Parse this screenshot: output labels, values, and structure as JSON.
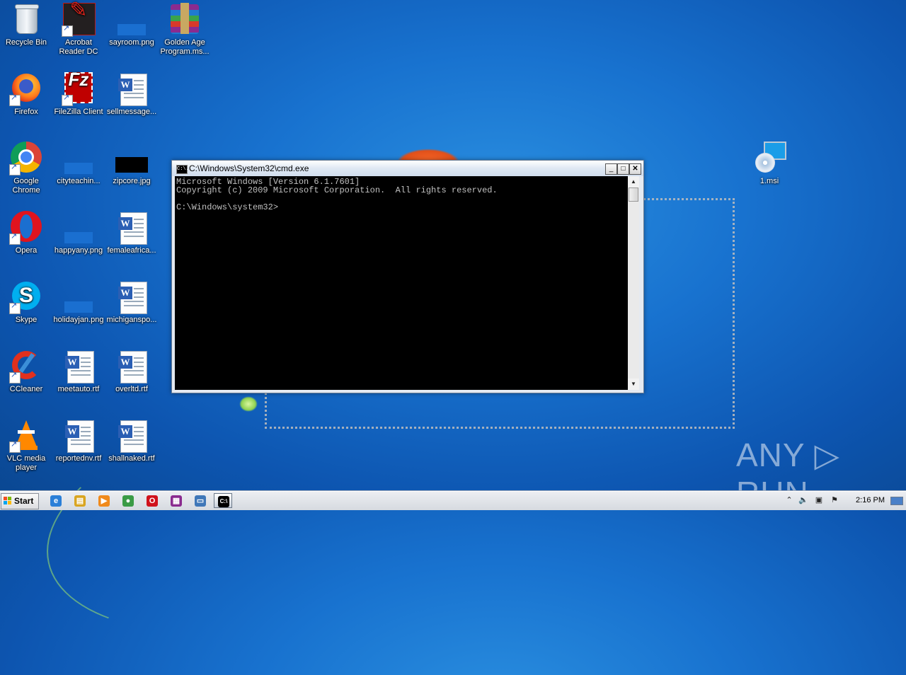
{
  "desktop_icons": [
    {
      "label": "Recycle Bin",
      "icon": "recycle-bin-icon"
    },
    {
      "label": "Acrobat Reader DC",
      "icon": "acrobat-icon"
    },
    {
      "label": "sayroom.png",
      "icon": "image-file-icon"
    },
    {
      "label": "Golden Age Program.ms...",
      "icon": "winrar-icon"
    },
    {
      "label": "Firefox",
      "icon": "firefox-icon"
    },
    {
      "label": "FileZilla Client",
      "icon": "filezilla-icon"
    },
    {
      "label": "sellmessage...",
      "icon": "word-doc-icon"
    },
    {
      "label": "Google Chrome",
      "icon": "chrome-icon"
    },
    {
      "label": "cityteachin...",
      "icon": "image-file-icon"
    },
    {
      "label": "zipcore.jpg",
      "icon": "image-file-icon"
    },
    {
      "label": "Opera",
      "icon": "opera-icon"
    },
    {
      "label": "happyany.png",
      "icon": "image-file-icon"
    },
    {
      "label": "femaleafrica...",
      "icon": "word-doc-icon"
    },
    {
      "label": "Skype",
      "icon": "skype-icon"
    },
    {
      "label": "holidayjan.png",
      "icon": "image-file-icon"
    },
    {
      "label": "michiganspo...",
      "icon": "word-doc-icon"
    },
    {
      "label": "CCleaner",
      "icon": "ccleaner-icon"
    },
    {
      "label": "meetauto.rtf",
      "icon": "word-doc-icon"
    },
    {
      "label": "overltd.rtf",
      "icon": "word-doc-icon"
    },
    {
      "label": "VLC media player",
      "icon": "vlc-icon"
    },
    {
      "label": "reportednv.rtf",
      "icon": "word-doc-icon"
    },
    {
      "label": "shallnaked.rtf",
      "icon": "word-doc-icon"
    },
    {
      "label": "1.msi",
      "icon": "msi-installer-icon"
    }
  ],
  "cmd_window": {
    "title": "C:\\Windows\\System32\\cmd.exe",
    "icon_text": "C:\\.",
    "minimize": "_",
    "maximize": "□",
    "close": "✕",
    "console_lines": "Microsoft Windows [Version 6.1.7601]\nCopyright (c) 2009 Microsoft Corporation.  All rights reserved.\n\nC:\\Windows\\system32>",
    "scroll_up": "▲",
    "scroll_down": "▼"
  },
  "watermark": "ANY ▷ RUN",
  "taskbar": {
    "start_label": "Start",
    "items": [
      {
        "icon": "internet-explorer-icon",
        "glyph": "e",
        "color": "#2a7fd8"
      },
      {
        "icon": "windows-explorer-icon",
        "glyph": "▤",
        "color": "#d9a520"
      },
      {
        "icon": "media-player-icon",
        "glyph": "▶",
        "color": "#f08a1c"
      },
      {
        "icon": "chrome-icon",
        "glyph": "●",
        "color": "#3a9b46"
      },
      {
        "icon": "opera-icon",
        "glyph": "O",
        "color": "#d0121c"
      },
      {
        "icon": "winrar-icon",
        "glyph": "▦",
        "color": "#8a2b8f"
      },
      {
        "icon": "remote-desktop-icon",
        "glyph": "▭",
        "color": "#3f77b8"
      },
      {
        "icon": "cmd-icon",
        "glyph": "C:\\",
        "color": "#000000"
      }
    ],
    "clock": "2:16 PM",
    "tray": {
      "show_hidden": "⌃",
      "volume": "🔈",
      "network": "▣",
      "flag": "⚑"
    }
  }
}
